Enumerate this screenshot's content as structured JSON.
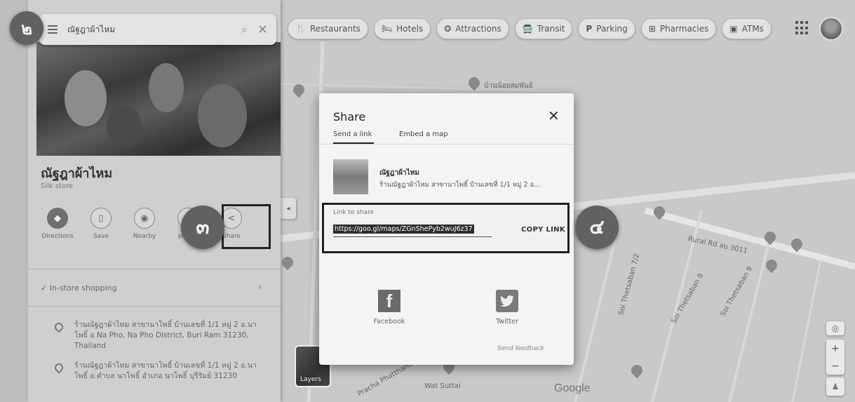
{
  "search": {
    "query": "ณัฐฎาผ้าไหม"
  },
  "chips": [
    {
      "icon": "restaurant-icon",
      "glyph": "🍴",
      "label": "Restaurants"
    },
    {
      "icon": "hotel-icon",
      "glyph": "🛏",
      "label": "Hotels"
    },
    {
      "icon": "attractions-icon",
      "glyph": "❂",
      "label": "Attractions"
    },
    {
      "icon": "transit-icon",
      "glyph": "🚍",
      "label": "Transit"
    },
    {
      "icon": "parking-icon",
      "glyph": "P",
      "label": "Parking"
    },
    {
      "icon": "pharmacy-icon",
      "glyph": "⊞",
      "label": "Pharmacies"
    },
    {
      "icon": "atm-icon",
      "glyph": "▣",
      "label": "ATMs"
    }
  ],
  "place": {
    "title": "ณัฐฎาผ้าไหม",
    "category": "Silk store",
    "actions": [
      {
        "name": "directions",
        "glyph": "◆",
        "label": "Directions"
      },
      {
        "name": "save",
        "glyph": "▯",
        "label": "Save"
      },
      {
        "name": "nearby",
        "glyph": "◉",
        "label": "Nearby"
      },
      {
        "name": "send-to-phone",
        "glyph": "▭",
        "label": "phone"
      },
      {
        "name": "share",
        "glyph": "<",
        "label": "Share"
      }
    ],
    "instore": "✓ In-store shopping",
    "addresses": [
      "ร้านณัฐฎาผ้าไหม สาขานาโพธิ์ บ้านเลขที่ 1/1 หมู่ 2 อ.นาโพธิ์ อ Na Pho, Na Pho District, Buri Ram 31230, Thailand",
      "ร้านณัฐฎาผ้าไหม สาขานาโพธิ์ บ้านเลขที่ 1/1 หมู่ 2 อ.นาโพธิ์ อ.ตำบล นาโพธิ์ อำเภอ นาโพธิ์ บุรีรัมย์ 31230"
    ]
  },
  "dialog": {
    "title": "Share",
    "close": "✕",
    "tabs": [
      "Send a link",
      "Embed a map"
    ],
    "place_name": "ณัฐฎาผ้าไหม",
    "place_address": "ร้านณัฐฎาผ้าไหม สาขานาโพธิ์ บ้านเลขที่ 1/1 หมู่ 2 อ...",
    "link_label": "Link to share",
    "link_url": "https://goo.gl/maps/ZGnShePyb2wuJ6z37",
    "copy_label": "COPY LINK",
    "facebook_label": "Facebook",
    "twitter_label": "Twitter",
    "feedback_label": "Send feedback"
  },
  "map": {
    "labels": [
      "บ้านน้อยสมพันธ์",
      "Rural Rd ลบ 3011",
      "Soi Thetsaban 7/2",
      "Soi Thetsaban 8",
      "Soi Thetsaban 9",
      "Wat Suttai",
      "Pracha Phatthana"
    ],
    "google": "Google",
    "layers": "Layers"
  },
  "callouts": [
    "๒",
    "๓",
    "๔"
  ]
}
